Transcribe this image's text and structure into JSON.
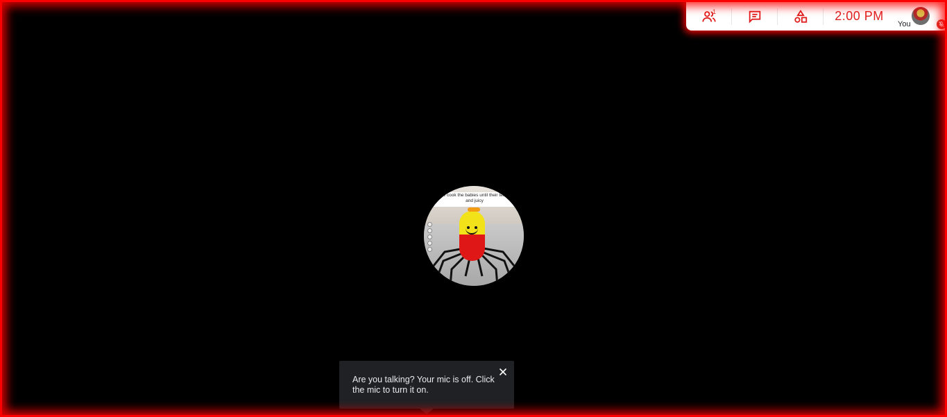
{
  "toolbar": {
    "participants_icon": "people-icon",
    "participants_count": "1",
    "chat_icon": "chat-icon",
    "activities_icon": "shapes-icon",
    "clock": "2:00  PM",
    "self_label": "You",
    "mic_state_icon": "mic-off-icon",
    "accent_color": "#e01e1e"
  },
  "video": {
    "caption": "now cook the babies until their tender and juicy"
  },
  "toast": {
    "message": "Are you talking? Your mic is off. Click the mic to turn it on.",
    "close_icon": "close-icon"
  },
  "colors": {
    "frame": "#ff0000",
    "toast_bg": "#202124"
  }
}
